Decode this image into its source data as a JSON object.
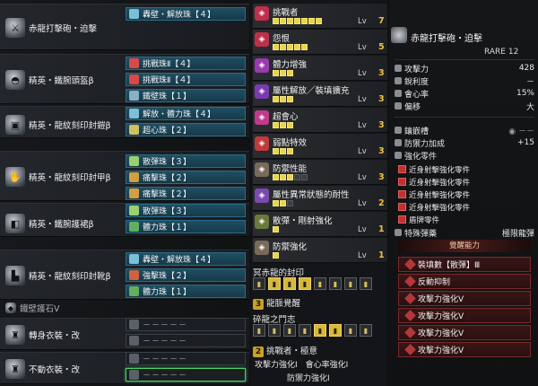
{
  "equipment": [
    {
      "name": "赤龍打擊砲・迫擊",
      "icon": "weapon-icon",
      "decos": [
        {
          "label": "轟壁・解放珠【４】",
          "color": "#7ac0d8"
        }
      ]
    },
    {
      "name": "精英・鐵腕頭盔β",
      "icon": "helm-icon",
      "decos": [
        {
          "label": "挑戰珠Ⅱ【４】",
          "color": "#d84a4a"
        },
        {
          "label": "挑戰珠Ⅱ【４】",
          "color": "#d84a4a"
        },
        {
          "label": "鐵壁珠【１】",
          "color": "#8ab0c8"
        }
      ]
    },
    {
      "name": "精英・龍紋刻印封鎧β",
      "icon": "chest-icon",
      "decos": [
        {
          "label": "解放・體力珠【４】",
          "color": "#7ac0d8"
        },
        {
          "label": "超心珠【２】",
          "color": "#d0c060"
        }
      ]
    },
    {
      "name": "精英・龍紋刻印封甲β",
      "icon": "arm-icon",
      "decos": [
        {
          "label": "散彈珠【３】",
          "color": "#9ad070"
        },
        {
          "label": "痛擊珠【２】",
          "color": "#d0a040"
        },
        {
          "label": "痛擊珠【２】",
          "color": "#d0a040"
        }
      ]
    },
    {
      "name": "精英・鐵腕護裙β",
      "icon": "waist-icon",
      "decos": [
        {
          "label": "散彈珠【３】",
          "color": "#9ad070"
        },
        {
          "label": "體力珠【１】",
          "color": "#60b060"
        }
      ]
    },
    {
      "name": "精英・龍紋刻印封靴β",
      "icon": "leg-icon",
      "decos": [
        {
          "label": "轟壁・解放珠【４】",
          "color": "#7ac0d8"
        },
        {
          "label": "強擊珠【２】",
          "color": "#d06040"
        },
        {
          "label": "體力珠【１】",
          "color": "#60b060"
        }
      ]
    }
  ],
  "charm": {
    "name": "鐵壁護石Ⅴ"
  },
  "mantles": [
    {
      "name": "轉身衣裝・改",
      "slots": [
        "－－－－－",
        "－－－－－"
      ]
    },
    {
      "name": "不動衣裝・改",
      "slots": [
        "－－－－－",
        "－－－－－"
      ]
    }
  ],
  "skills": [
    {
      "name": "挑戰者",
      "lv_label": "Lv",
      "level": "7",
      "max": 7,
      "color": "#c0304a",
      "icon": "challenger-icon"
    },
    {
      "name": "怨恨",
      "lv_label": "Lv",
      "level": "5",
      "max": 5,
      "color": "#c0304a",
      "icon": "resentment-icon"
    },
    {
      "name": "體力增強",
      "lv_label": "Lv",
      "level": "3",
      "max": 3,
      "color": "#9a3ab0",
      "icon": "health-icon"
    },
    {
      "name": "屬性解放／裝填擴充",
      "lv_label": "Lv",
      "level": "3",
      "max": 3,
      "color": "#7a3ab0",
      "icon": "element-icon"
    },
    {
      "name": "超會心",
      "lv_label": "Lv",
      "level": "3",
      "max": 3,
      "color": "#c03a8a",
      "icon": "critical-icon"
    },
    {
      "name": "弱點特效",
      "lv_label": "Lv",
      "level": "3",
      "max": 3,
      "color": "#c03a3a",
      "icon": "weakness-icon"
    },
    {
      "name": "防禦性能",
      "lv_label": "Lv",
      "level": "3",
      "max": 5,
      "color": "#7a6a5a",
      "icon": "guard-icon"
    },
    {
      "name": "屬性異常狀態的耐性",
      "lv_label": "Lv",
      "level": "2",
      "max": 3,
      "color": "#7a4ab0",
      "icon": "resist-icon"
    },
    {
      "name": "散彈・剛射強化",
      "lv_label": "Lv",
      "level": "1",
      "max": 1,
      "color": "#6a7a3a",
      "icon": "spread-icon"
    },
    {
      "name": "防禦強化",
      "lv_label": "Lv",
      "level": "1",
      "max": 1,
      "color": "#7a6a5a",
      "icon": "guard-up-icon"
    }
  ],
  "set_bonus_1": {
    "title": "冥赤龍的封印",
    "rank": "3",
    "skill": "龍脈覺醒"
  },
  "set_bonus_2": {
    "title": "碎龍之鬥志",
    "rank": "2",
    "skill": "挑戰者・極意"
  },
  "set_skills": [
    "攻擊力強化Ⅰ",
    "會心率強化Ⅰ",
    "防禦力強化Ⅰ"
  ],
  "weapon": {
    "name": "赤龍打擊砲・迫擊",
    "rarity": "RARE 12",
    "stats": [
      {
        "label": "攻擊力",
        "value": "428"
      },
      {
        "label": "銳利度",
        "value": "－"
      },
      {
        "label": "會心率",
        "value": "15%"
      },
      {
        "label": "偏移",
        "value": "大"
      }
    ],
    "slot_label": "鑲嵌槽",
    "defense_label": "防禦力加成",
    "defense_value": "+15",
    "mods_title": "強化零件",
    "mods": [
      "近身射擊強化零件",
      "近身射擊強化零件",
      "近身射擊強化零件",
      "近身射擊強化零件",
      "盾牌零件"
    ],
    "special_ammo_label": "特殊彈藥",
    "special_ammo_value": "極限龍彈",
    "awakening_title": "覺醒能力",
    "awakenings": [
      "裝填數【散彈】Ⅲ",
      "反動抑制",
      "攻擊力強化Ⅴ",
      "攻擊力強化Ⅴ",
      "攻擊力強化Ⅴ",
      "攻擊力強化Ⅴ"
    ]
  }
}
